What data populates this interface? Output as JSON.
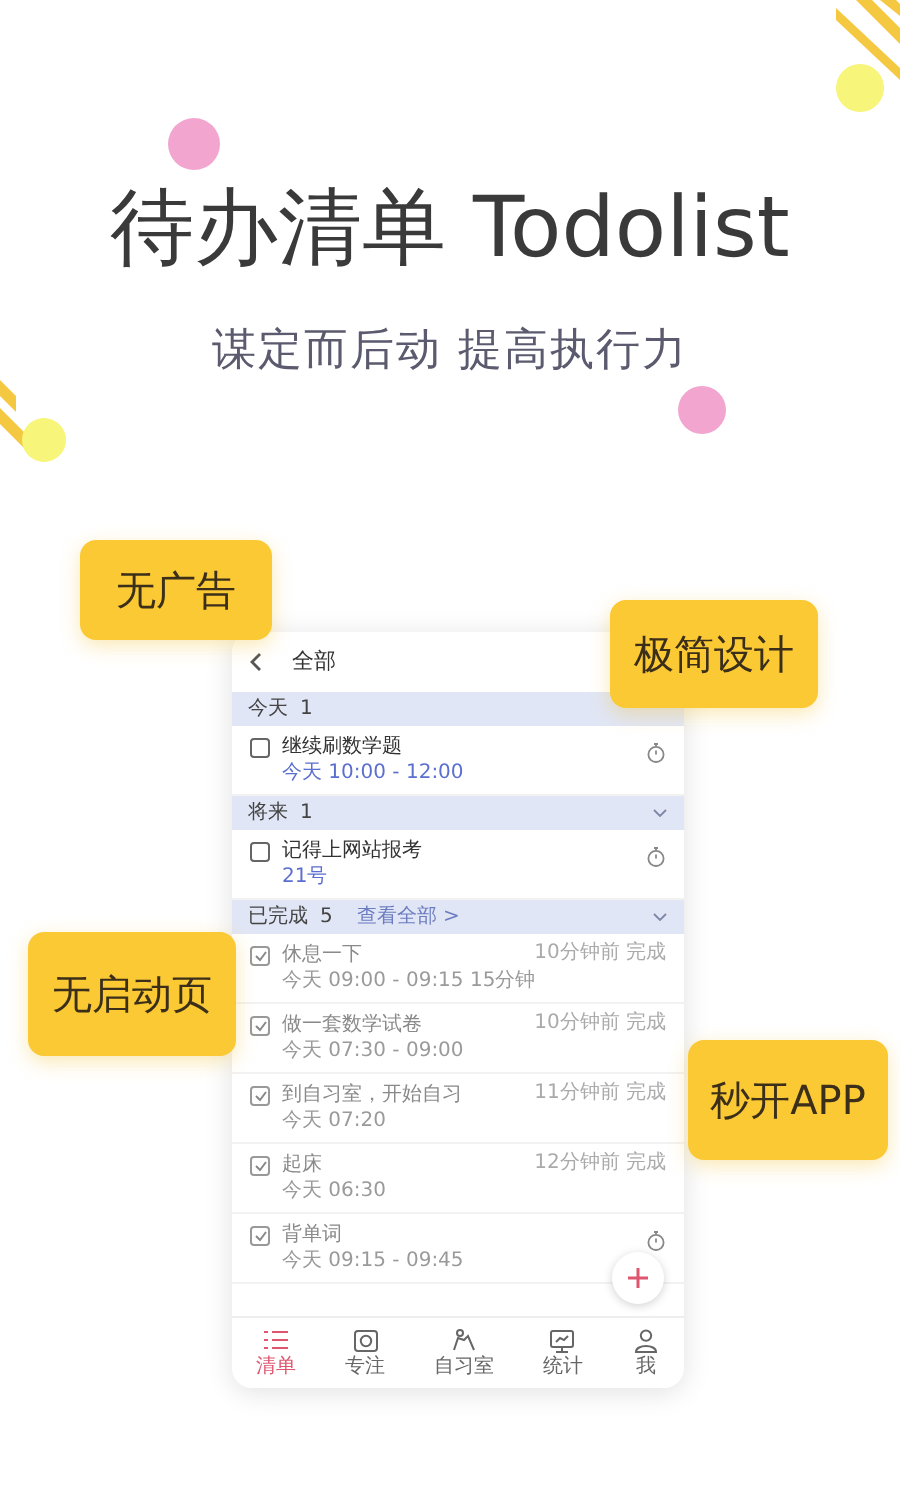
{
  "title": "待办清单 Todolist",
  "subtitle": "谋定而后动 提高执行力",
  "app": {
    "header": {
      "title": "全部"
    },
    "sections": [
      {
        "label": "今天",
        "count": "1",
        "expanded": true,
        "chevron": false,
        "items": [
          {
            "title": "继续刷数学题",
            "when": "今天  10:00 - 12:00",
            "checked": false,
            "timer": true
          }
        ]
      },
      {
        "label": "将来",
        "count": "1",
        "expanded": true,
        "chevron": true,
        "items": [
          {
            "title": "记得上网站报考",
            "when": "21号",
            "checked": false,
            "timer": true
          }
        ]
      },
      {
        "label": "已完成",
        "count": "5",
        "link": "查看全部 >",
        "expanded": true,
        "chevron": true,
        "items": [
          {
            "title": "休息一下",
            "when": "今天  09:00 - 09:15  15分钟",
            "note": "10分钟前 完成",
            "checked": true,
            "timer": false
          },
          {
            "title": "做一套数学试卷",
            "when": "今天  07:30 - 09:00",
            "note": "10分钟前 完成",
            "checked": true,
            "timer": false
          },
          {
            "title": "到自习室，开始自习",
            "when": "今天  07:20",
            "note": "11分钟前 完成",
            "checked": true,
            "timer": false
          },
          {
            "title": "起床",
            "when": "今天  06:30",
            "note": "12分钟前 完成",
            "checked": true,
            "timer": false
          },
          {
            "title": "背单词",
            "when": "今天  09:15 - 09:45",
            "checked": true,
            "timer": true
          }
        ]
      }
    ],
    "tabs": [
      {
        "label": "清单",
        "selected": true
      },
      {
        "label": "专注",
        "selected": false
      },
      {
        "label": "自习室",
        "selected": false
      },
      {
        "label": "统计",
        "selected": false
      },
      {
        "label": "我",
        "selected": false
      }
    ]
  },
  "callouts": [
    {
      "text": "无广告"
    },
    {
      "text": "极简设计"
    },
    {
      "text": "无启动页"
    },
    {
      "text": "秒开APP"
    }
  ]
}
